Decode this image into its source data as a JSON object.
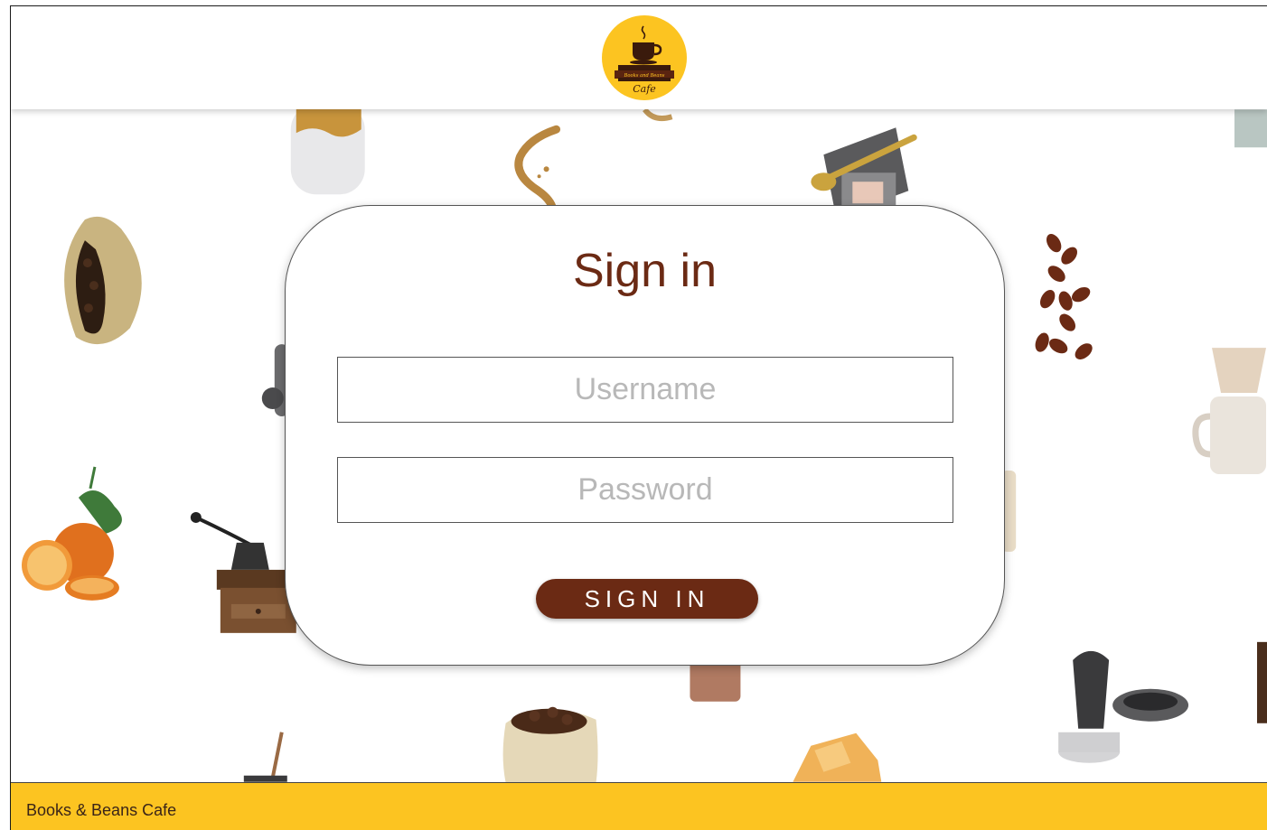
{
  "header": {
    "logo_text_top": "Books and Beans",
    "logo_text_bottom": "Cafe",
    "logo_icon": "coffee-cup-on-books-icon"
  },
  "signin": {
    "title": "Sign in",
    "username_placeholder": "Username",
    "password_placeholder": "Password",
    "button_label": "SIGN IN"
  },
  "footer": {
    "text": "Books & Beans Cafe"
  },
  "colors": {
    "brand_brown": "#6b2a14",
    "brand_yellow": "#fcc421",
    "placeholder_gray": "#b8b8b8"
  },
  "background_decor": [
    "milk-bottle-icon",
    "coffee-steam-icon",
    "coffee-bag-scoop-icon",
    "cocoa-pod-icon",
    "coffee-beans-icon",
    "pour-over-mug-icon",
    "orange-slices-icon",
    "coffee-grinder-icon",
    "coffee-tamper-icon",
    "coffee-sack-icon",
    "sugar-cubes-icon",
    "stir-stick-icon"
  ]
}
